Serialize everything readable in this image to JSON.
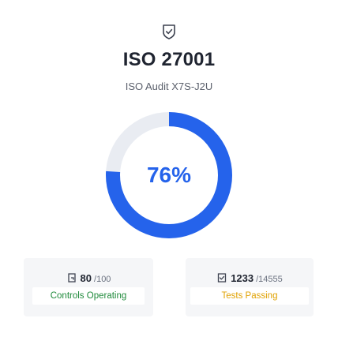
{
  "header": {
    "icon": "shield-check-icon",
    "title": "ISO 27001",
    "subtitle": "ISO Audit X7S-J2U"
  },
  "progress": {
    "value": 0.76,
    "label": "76%",
    "color": "#2563eb",
    "track_color": "#e9ecf2"
  },
  "stats": {
    "controls": {
      "icon": "control-icon",
      "value": "80",
      "total": "/100",
      "label": "Controls Operating",
      "label_color": "#1f8a3b"
    },
    "tests": {
      "icon": "test-icon",
      "value": "1233",
      "total": "/14555",
      "label": "Tests Passing",
      "label_color": "#e0a100"
    }
  }
}
